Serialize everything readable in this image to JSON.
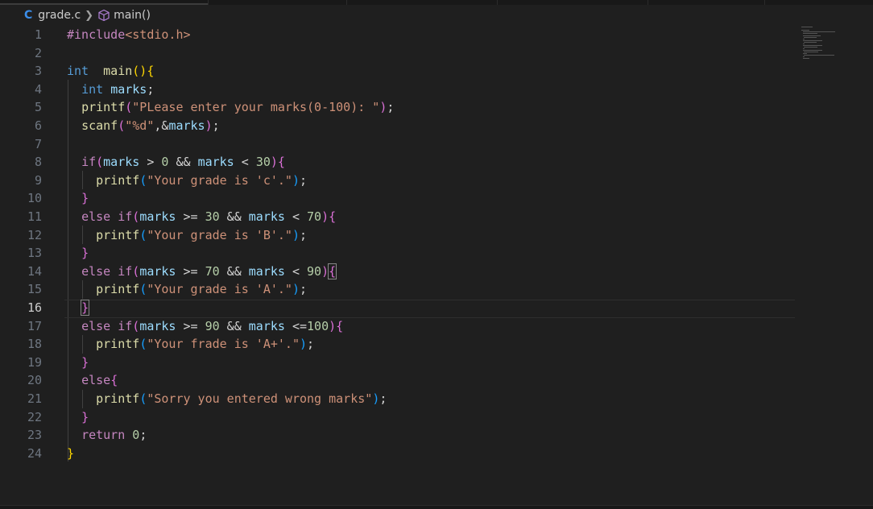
{
  "breadcrumb": {
    "file_icon": "C",
    "file": "grade.c",
    "symbol_icon": "cube-icon",
    "symbol": "main()"
  },
  "editor": {
    "active_line": 16,
    "lines": [
      {
        "n": "1",
        "tokens": [
          [
            "pre",
            "#include"
          ],
          [
            "inc",
            "<stdio.h>"
          ]
        ]
      },
      {
        "n": "2",
        "tokens": []
      },
      {
        "n": "3",
        "tokens": [
          [
            "kw",
            "int"
          ],
          [
            "",
            "  "
          ],
          [
            "fn",
            "main"
          ],
          [
            "b1",
            "()"
          ],
          [
            "b1",
            "{"
          ]
        ]
      },
      {
        "n": "4",
        "tokens": [
          [
            "",
            "  "
          ],
          [
            "kw",
            "int"
          ],
          [
            "",
            " "
          ],
          [
            "var",
            "marks"
          ],
          [
            "",
            ";"
          ]
        ]
      },
      {
        "n": "5",
        "tokens": [
          [
            "",
            "  "
          ],
          [
            "fn",
            "printf"
          ],
          [
            "b2",
            "("
          ],
          [
            "str",
            "\"PLease enter your marks(0-100): \""
          ],
          [
            "b2",
            ")"
          ],
          [
            "",
            ";"
          ]
        ]
      },
      {
        "n": "6",
        "tokens": [
          [
            "",
            "  "
          ],
          [
            "fn",
            "scanf"
          ],
          [
            "b2",
            "("
          ],
          [
            "str",
            "\"%d\""
          ],
          [
            "",
            ",&"
          ],
          [
            "var",
            "marks"
          ],
          [
            "b2",
            ")"
          ],
          [
            "",
            ";"
          ]
        ]
      },
      {
        "n": "7",
        "tokens": []
      },
      {
        "n": "8",
        "tokens": [
          [
            "",
            "  "
          ],
          [
            "ctl",
            "if"
          ],
          [
            "b2",
            "("
          ],
          [
            "var",
            "marks"
          ],
          [
            "",
            " > "
          ],
          [
            "num",
            "0"
          ],
          [
            "",
            " && "
          ],
          [
            "var",
            "marks"
          ],
          [
            "",
            " < "
          ],
          [
            "num",
            "30"
          ],
          [
            "b2",
            ")"
          ],
          [
            "b2",
            "{"
          ]
        ]
      },
      {
        "n": "9",
        "tokens": [
          [
            "",
            "    "
          ],
          [
            "fn",
            "printf"
          ],
          [
            "b3",
            "("
          ],
          [
            "str",
            "\"Your grade is 'c'.\""
          ],
          [
            "b3",
            ")"
          ],
          [
            "",
            ";"
          ]
        ]
      },
      {
        "n": "10",
        "tokens": [
          [
            "",
            "  "
          ],
          [
            "b2",
            "}"
          ]
        ]
      },
      {
        "n": "11",
        "tokens": [
          [
            "",
            "  "
          ],
          [
            "ctl",
            "else"
          ],
          [
            "",
            " "
          ],
          [
            "ctl",
            "if"
          ],
          [
            "b2",
            "("
          ],
          [
            "var",
            "marks"
          ],
          [
            "",
            " >= "
          ],
          [
            "num",
            "30"
          ],
          [
            "",
            " && "
          ],
          [
            "var",
            "marks"
          ],
          [
            "",
            " < "
          ],
          [
            "num",
            "70"
          ],
          [
            "b2",
            ")"
          ],
          [
            "b2",
            "{"
          ]
        ]
      },
      {
        "n": "12",
        "tokens": [
          [
            "",
            "    "
          ],
          [
            "fn",
            "printf"
          ],
          [
            "b3",
            "("
          ],
          [
            "str",
            "\"Your grade is 'B'.\""
          ],
          [
            "b3",
            ")"
          ],
          [
            "",
            ";"
          ]
        ]
      },
      {
        "n": "13",
        "tokens": [
          [
            "",
            "  "
          ],
          [
            "b2",
            "}"
          ]
        ]
      },
      {
        "n": "14",
        "tokens": [
          [
            "",
            "  "
          ],
          [
            "ctl",
            "else"
          ],
          [
            "",
            " "
          ],
          [
            "ctl",
            "if"
          ],
          [
            "b2",
            "("
          ],
          [
            "var",
            "marks"
          ],
          [
            "",
            " >= "
          ],
          [
            "num",
            "70"
          ],
          [
            "",
            " && "
          ],
          [
            "var",
            "marks"
          ],
          [
            "",
            " < "
          ],
          [
            "num",
            "90"
          ],
          [
            "b2",
            ")"
          ],
          [
            "b2 bm",
            "{"
          ]
        ]
      },
      {
        "n": "15",
        "tokens": [
          [
            "",
            "    "
          ],
          [
            "fn",
            "printf"
          ],
          [
            "b3",
            "("
          ],
          [
            "str",
            "\"Your grade is 'A'.\""
          ],
          [
            "b3",
            ")"
          ],
          [
            "",
            ";"
          ]
        ]
      },
      {
        "n": "16",
        "tokens": [
          [
            "",
            "  "
          ],
          [
            "b2 bm",
            "}"
          ]
        ]
      },
      {
        "n": "17",
        "tokens": [
          [
            "",
            "  "
          ],
          [
            "ctl",
            "else"
          ],
          [
            "",
            " "
          ],
          [
            "ctl",
            "if"
          ],
          [
            "b2",
            "("
          ],
          [
            "var",
            "marks"
          ],
          [
            "",
            " >= "
          ],
          [
            "num",
            "90"
          ],
          [
            "",
            " && "
          ],
          [
            "var",
            "marks"
          ],
          [
            "",
            " <="
          ],
          [
            "num",
            "100"
          ],
          [
            "b2",
            ")"
          ],
          [
            "b2",
            "{"
          ]
        ]
      },
      {
        "n": "18",
        "tokens": [
          [
            "",
            "    "
          ],
          [
            "fn",
            "printf"
          ],
          [
            "b3",
            "("
          ],
          [
            "str",
            "\"Your frade is 'A+'.\""
          ],
          [
            "b3",
            ")"
          ],
          [
            "",
            ";"
          ]
        ]
      },
      {
        "n": "19",
        "tokens": [
          [
            "",
            "  "
          ],
          [
            "b2",
            "}"
          ]
        ]
      },
      {
        "n": "20",
        "tokens": [
          [
            "",
            "  "
          ],
          [
            "ctl",
            "else"
          ],
          [
            "b2",
            "{"
          ]
        ]
      },
      {
        "n": "21",
        "tokens": [
          [
            "",
            "    "
          ],
          [
            "fn",
            "printf"
          ],
          [
            "b3",
            "("
          ],
          [
            "str",
            "\"Sorry you entered wrong marks\""
          ],
          [
            "b3",
            ")"
          ],
          [
            "",
            ";"
          ]
        ]
      },
      {
        "n": "22",
        "tokens": [
          [
            "",
            "  "
          ],
          [
            "b2",
            "}"
          ]
        ]
      },
      {
        "n": "23",
        "tokens": [
          [
            "",
            "  "
          ],
          [
            "ctl",
            "return"
          ],
          [
            "",
            " "
          ],
          [
            "num",
            "0"
          ],
          [
            "",
            ";"
          ]
        ]
      },
      {
        "n": "24",
        "tokens": [
          [
            "b1",
            "}"
          ]
        ]
      }
    ]
  },
  "colors": {
    "background": "#1f1f1f",
    "keyword": "#569cd6",
    "control": "#c586c0",
    "function": "#dcdcaa",
    "variable": "#9cdcfe",
    "string": "#ce9178",
    "number": "#b5cea8"
  }
}
